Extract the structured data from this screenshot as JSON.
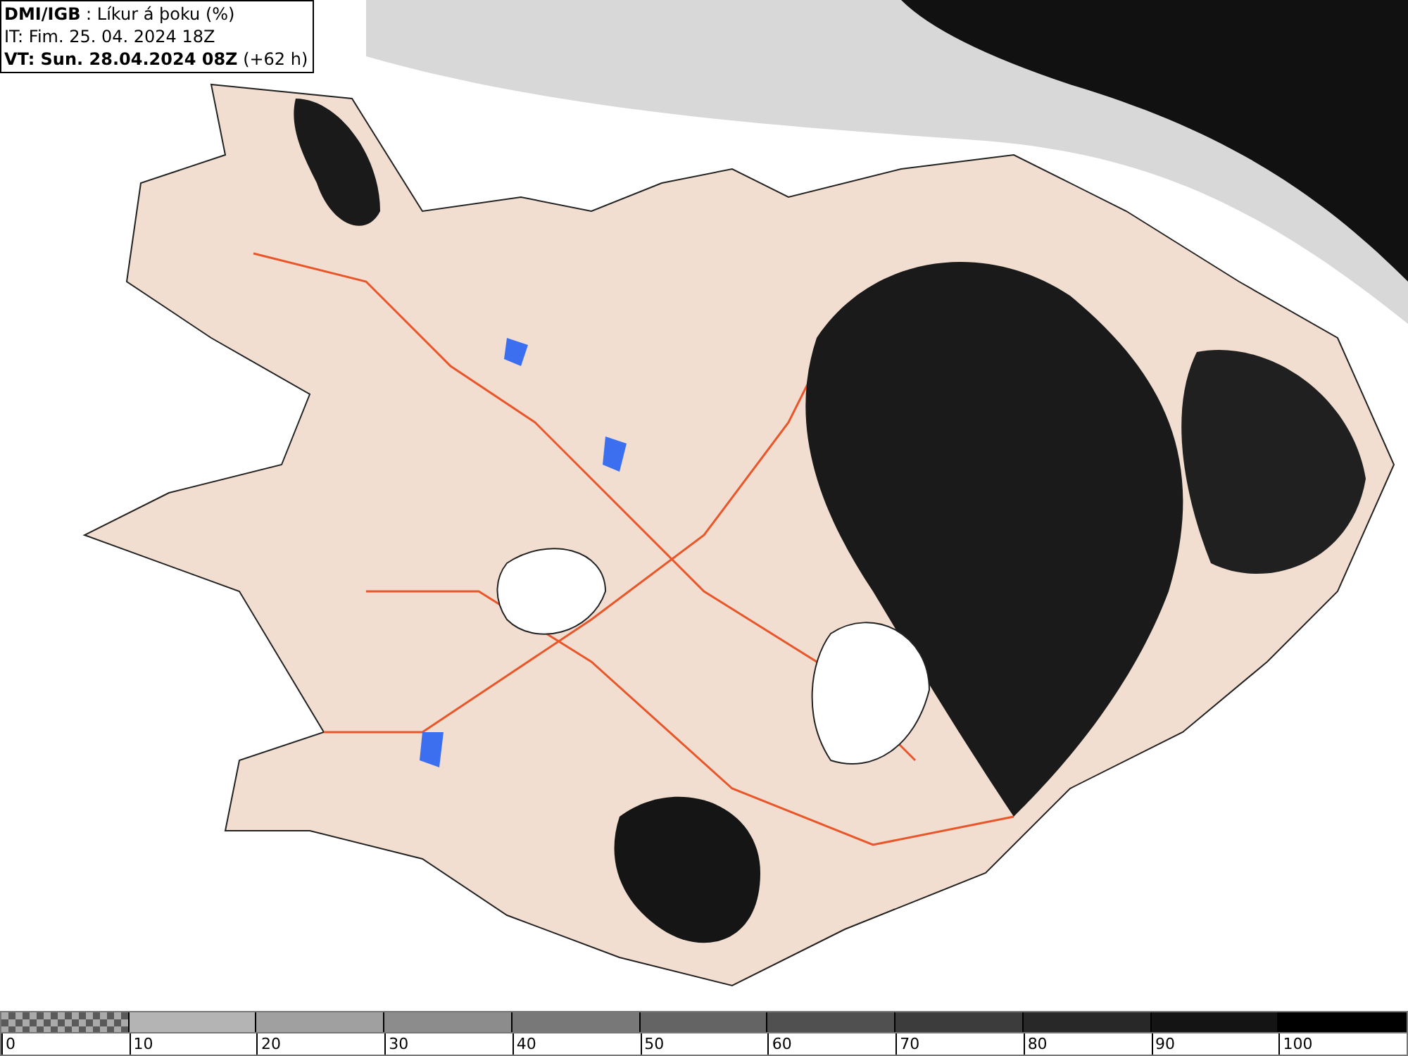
{
  "header": {
    "lines": [
      "**DMI/IGB** : Líkur á þoku (%)",
      "IT: Fim. 25. 04. 2024 18Z",
      "**VT: Sun. 28.04.2024 08Z** (+62 h)"
    ]
  },
  "legend": {
    "segments": [
      {
        "kind": "checker",
        "color": "#5a5a5a"
      },
      {
        "kind": "solid",
        "color": "#b4b4b4"
      },
      {
        "kind": "solid",
        "color": "#a0a0a0"
      },
      {
        "kind": "solid",
        "color": "#8c8c8c"
      },
      {
        "kind": "solid",
        "color": "#787878"
      },
      {
        "kind": "solid",
        "color": "#646464"
      },
      {
        "kind": "solid",
        "color": "#505050"
      },
      {
        "kind": "solid",
        "color": "#3c3c3c"
      },
      {
        "kind": "solid",
        "color": "#282828"
      },
      {
        "kind": "solid",
        "color": "#141414"
      },
      {
        "kind": "solid",
        "color": "#000000"
      }
    ],
    "labels": [
      "0",
      "10",
      "20",
      "30",
      "40",
      "50",
      "60",
      "70",
      "80",
      "90",
      "100"
    ]
  }
}
